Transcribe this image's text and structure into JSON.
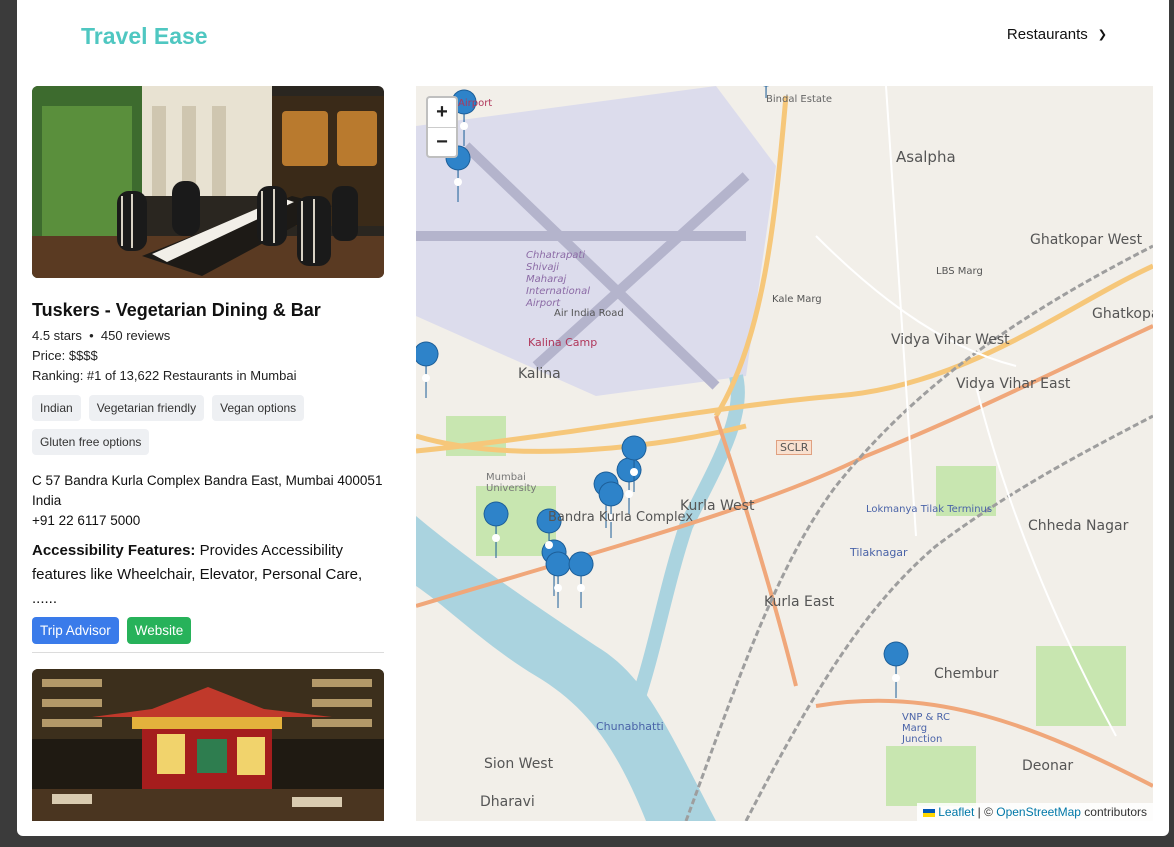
{
  "header": {
    "brand": "Travel Ease",
    "category": "Restaurants"
  },
  "listing": {
    "name": "Tuskers - Vegetarian Dining & Bar",
    "stars": "4.5 stars",
    "separator": "•",
    "reviews": "450 reviews",
    "price": "Price: $$$$",
    "ranking": "Ranking: #1 of 13,622 Restaurants in Mumbai",
    "tags": [
      "Indian",
      "Vegetarian friendly",
      "Vegan options",
      "Gluten free options"
    ],
    "address_line1": "C 57 Bandra Kurla Complex Bandra East, Mumbai 400051",
    "address_line2": "India",
    "phone": "+91 22 6117 5000",
    "access_label": "Accessibility Features:",
    "access_text": "Provides Accessibility features like Wheelchair, Elevator, Personal Care,",
    "access_more": "......",
    "btn_tripadvisor": "Trip Advisor",
    "btn_website": "Website"
  },
  "map": {
    "zoom_in": "+",
    "zoom_out": "−",
    "attribution_leaflet": "Leaflet",
    "attribution_sep": " | © ",
    "attribution_osm": "OpenStreetMap",
    "attribution_tail": " contributors",
    "labels": [
      "Asalpha",
      "Ghatkopar West",
      "Ghatkopar East",
      "Vidya Vihar West",
      "Vidya Vihar East",
      "Kalina",
      "Kalina Camp",
      "Chhatrapati Shivaji Maharaj International Airport",
      "Air India Road",
      "Mumbai University",
      "Bandra Kurla Complex",
      "Kurla West",
      "Kurla East",
      "SCLR",
      "Lokmanya Tilak Terminus",
      "Tilaknagar",
      "Chheda Nagar",
      "Chembur",
      "VNP & RC Marg Junction",
      "Deonar",
      "Sion West",
      "Dharavi",
      "Chunabhatti",
      "Kale Marg",
      "LBS Marg",
      "Bindal Estate",
      "Airport"
    ]
  }
}
